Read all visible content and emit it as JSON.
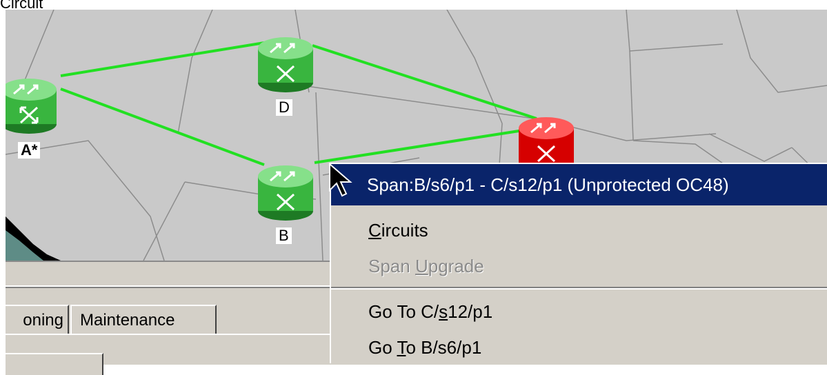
{
  "top_label": "Circuit",
  "map": {
    "nodes": [
      {
        "id": "A",
        "label": "A*",
        "status": "ok"
      },
      {
        "id": "D",
        "label": "D",
        "status": "ok"
      },
      {
        "id": "B",
        "label": "B",
        "status": "ok"
      },
      {
        "id": "C",
        "label": "",
        "status": "critical"
      }
    ],
    "colors": {
      "ok_node": "#33b43a",
      "critical_node": "#e00000",
      "span": "#22e022",
      "map_bg": "#c9c9c9"
    }
  },
  "tabs": {
    "provisioning": "oning",
    "maintenance": "Maintenance"
  },
  "context_menu": {
    "header": "Span:B/s6/p1 - C/s12/p1 (Unprotected OC48)",
    "circuits": {
      "mnemonic": "C",
      "rest": "ircuits"
    },
    "span_upgrade": {
      "before": "Span ",
      "mnemonic": "U",
      "after": "pgrade"
    },
    "goto_c": {
      "before": "Go To C/",
      "mnemonic": "s",
      "after": "12/p1"
    },
    "goto_b": {
      "before": "Go ",
      "mnemonic": "T",
      "after": "o B/s6/p1"
    }
  }
}
